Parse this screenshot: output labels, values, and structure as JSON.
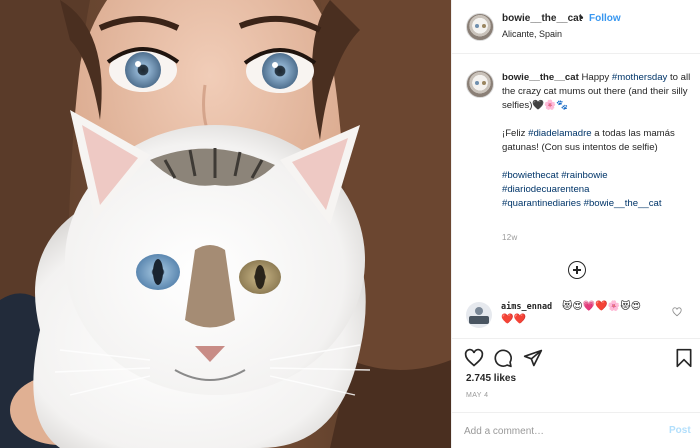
{
  "post": {
    "username": "bowie__the__cat",
    "follow_label": "Follow",
    "location": "Alicante, Spain",
    "dot": "•"
  },
  "caption": {
    "username": "bowie__the__cat",
    "line1_before": " Happy ",
    "line1_tag": "#mothersday",
    "line1_after": " to all the crazy cat mums out there (and their silly selfies)🖤🌸🐾",
    "p2_before": "¡Feliz ",
    "p2_tag": "#diadelamadre",
    "p2_after": " a todas las mamás gatunas! (Con sus intentos de selfie)",
    "hashtags": [
      "#bowiethecat",
      "#rainbowie",
      "#diariodecuarentena",
      "#quarantinediaries",
      "#bowie__the__cat"
    ],
    "time": "12w"
  },
  "comment": {
    "username": "aims_ennad",
    "emoji_line1": "😻😍💗❤️🌸😻😍",
    "emoji_line2": "❤️❤️"
  },
  "likes": "2.745 likes",
  "date": "MAY 4",
  "add_comment": {
    "placeholder": "Add a comment…",
    "post_label": "Post"
  },
  "colors": {
    "link": "#003569",
    "follow": "#3897f0",
    "post_disabled": "#b2dffc"
  },
  "icons": [
    "heart-icon",
    "comment-icon",
    "share-icon",
    "bookmark-icon",
    "plus-circle-icon",
    "small-heart-icon"
  ]
}
